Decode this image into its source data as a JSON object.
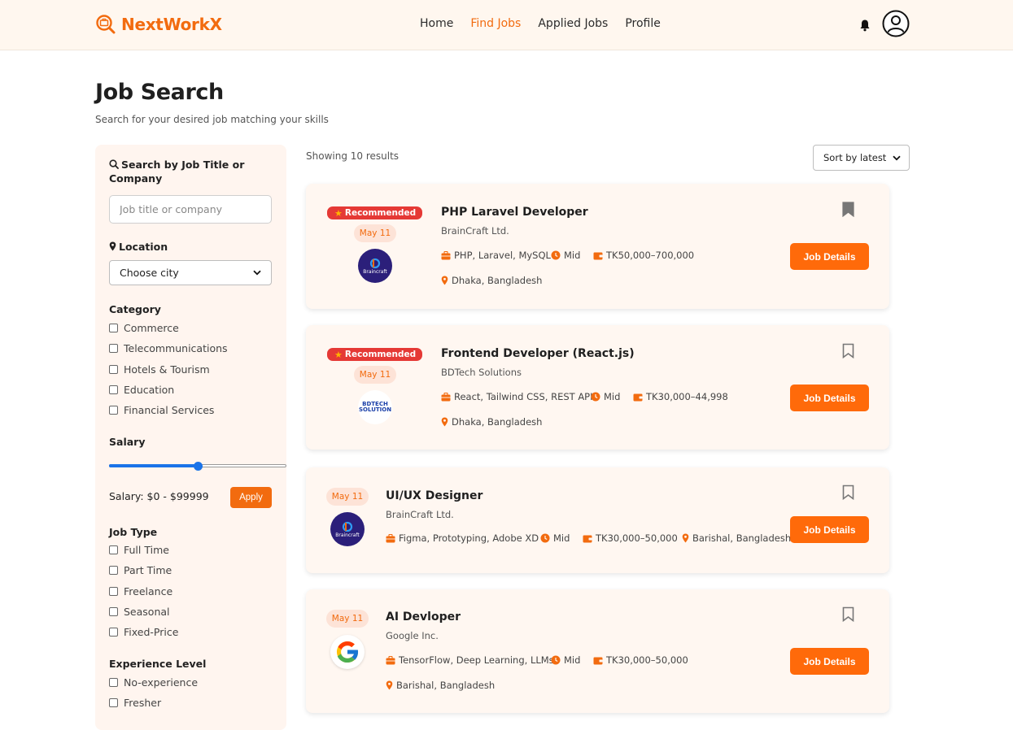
{
  "brand": {
    "name": "NextWorkX"
  },
  "nav": {
    "home": "Home",
    "find_jobs": "Find Jobs",
    "applied_jobs": "Applied Jobs",
    "profile": "Profile"
  },
  "page": {
    "title": "Job Search",
    "subtitle": "Search for your desired job matching your skills"
  },
  "filters": {
    "search_label": "Search by Job Title or Company",
    "search_placeholder": "Job title or company",
    "location_label": "Location",
    "location_value": "Choose city",
    "category_label": "Category",
    "categories": [
      "Commerce",
      "Telecommunications",
      "Hotels & Tourism",
      "Education",
      "Financial Services"
    ],
    "salary_label": "Salary",
    "salary_slider_fraction": 0.5,
    "salary_text": "Salary: $0 - $99999",
    "apply_label": "Apply",
    "job_type_label": "Job Type",
    "job_types": [
      "Full Time",
      "Part Time",
      "Freelance",
      "Seasonal",
      "Fixed-Price"
    ],
    "experience_label": "Experience Level",
    "experience_levels": [
      "No-experience",
      "Fresher"
    ]
  },
  "results": {
    "showing": "Showing 10 results",
    "sort_value": "Sort by latest"
  },
  "jobs": [
    {
      "recommended": "Recommended",
      "date": "May 11",
      "logo": "Braincraft",
      "title": "PHP Laravel Developer",
      "company": "BrainCraft Ltd.",
      "skills": "PHP, Laravel, MySQL",
      "level": "Mid",
      "salary": "TK50,000–700,000",
      "location": "Dhaka, Bangladesh",
      "saved": true,
      "button": "Job Details"
    },
    {
      "recommended": "Recommended",
      "date": "May 11",
      "logo": "BDTECH SOLUTION",
      "title": "Frontend Developer (React.js)",
      "company": "BDTech Solutions",
      "skills": "React, Tailwind CSS, REST API",
      "level": "Mid",
      "salary": "TK30,000–44,998",
      "location": "Dhaka, Bangladesh",
      "saved": false,
      "button": "Job Details"
    },
    {
      "date": "May 11",
      "logo": "Braincraft",
      "title": "UI/UX Designer",
      "company": "BrainCraft Ltd.",
      "skills": "Figma, Prototyping, Adobe XD",
      "level": "Mid",
      "salary": "TK30,000–50,000",
      "location": "Barishal, Bangladesh",
      "saved": false,
      "button": "Job Details"
    },
    {
      "date": "May 11",
      "logo": "google-logo",
      "title": "AI Devloper",
      "company": "Google Inc.",
      "skills": "TensorFlow, Deep Learning, LLMs",
      "level": "Mid",
      "salary": "TK30,000–50,000",
      "location": "Barishal, Bangladesh",
      "saved": false,
      "button": "Job Details"
    }
  ],
  "colors": {
    "accent": "#f26b0f",
    "recommended": "#e53935",
    "slider": "#1a73e8"
  }
}
